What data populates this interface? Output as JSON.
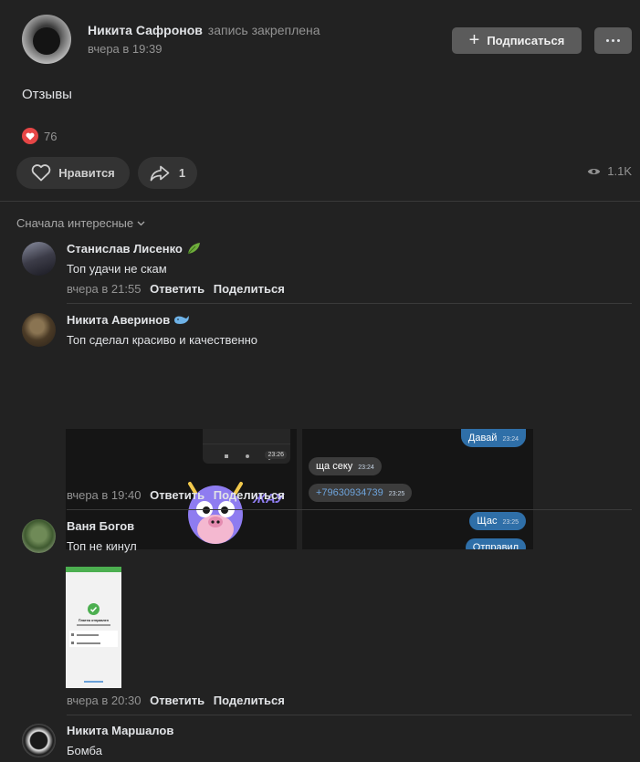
{
  "post": {
    "author": "Никита Сафронов",
    "pinned": "запись закреплена",
    "time": "вчера в 19:39",
    "subscribe_label": "Подписаться",
    "text": "Отзывы",
    "reactions_count": "76",
    "like_label": "Нравится",
    "share_count": "1",
    "views": "1.1K",
    "heart_color": "#e64646"
  },
  "sort": {
    "label": "Сначала интересные"
  },
  "comments": [
    {
      "name": "Станислав Лисенко",
      "text": "Топ удачи не скам",
      "time": "вчера в 21:55",
      "reply": "Ответить",
      "share": "Поделиться"
    },
    {
      "name": "Никита Аверинов",
      "text": "Топ сделал красиво и качественно",
      "time": "вчера в 19:40",
      "reply": "Ответить",
      "share": "Поделиться",
      "image1": {
        "time": "23:26",
        "sticker_text": "ЖАУ"
      },
      "image2": {
        "b1": "Давай",
        "b1_time": "23:24",
        "b2": "ща секу",
        "b2_time": "23:24",
        "b3": "+79630934739",
        "b3_time": "23:25",
        "b4": "Щас",
        "b4_time": "23:25",
        "b5": "Отправил"
      }
    },
    {
      "name": "Ваня Богов",
      "text": "Топ не кинул",
      "time": "вчера в 20:30",
      "reply": "Ответить",
      "share": "Поделиться",
      "image": {
        "title": "Платеж отправлен"
      }
    },
    {
      "name": "Никита Маршалов",
      "text": "Бомба"
    }
  ]
}
